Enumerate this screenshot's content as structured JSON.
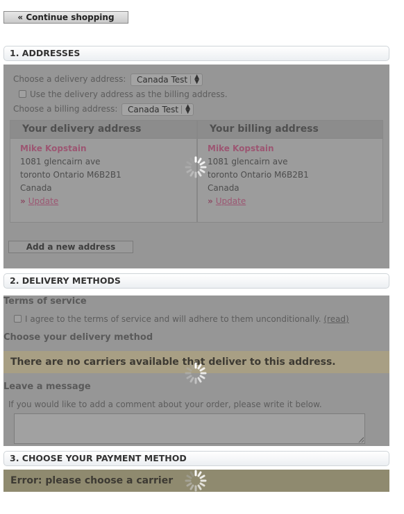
{
  "continue_shopping": {
    "label": "« Continue shopping"
  },
  "steps": {
    "addresses": {
      "title": "1. ADDRESSES",
      "delivery_label": "Choose a delivery address:",
      "delivery_selected": "Canada Test",
      "same_billing_label": "Use the delivery address as the billing address.",
      "billing_label": "Choose a billing address:",
      "billing_selected": "Canada Test",
      "delivery_box": {
        "title": "Your delivery address",
        "name": "Mike Kopstain",
        "line1": "1081 glencairn ave",
        "line2": "toronto Ontario M6B2B1",
        "country": "Canada",
        "update": "Update"
      },
      "billing_box": {
        "title": "Your billing address",
        "name": "Mike Kopstain",
        "line1": "1081 glencairn ave",
        "line2": "toronto Ontario M6B2B1",
        "country": "Canada",
        "update": "Update"
      },
      "add_new": "Add a new address"
    },
    "delivery": {
      "title": "2. DELIVERY METHODS",
      "terms_heading": "Terms of service",
      "terms_label": "I agree to the terms of service and will adhere to them unconditionally.",
      "terms_link": "(read)",
      "method_heading": "Choose your delivery method",
      "no_carriers": "There are no carriers available that deliver to this address.",
      "message_heading": "Leave a message",
      "message_hint": "If you would like to add a comment about your order, please write it below.",
      "message_value": ""
    },
    "payment": {
      "title": "3. CHOOSE YOUR PAYMENT METHOD",
      "error": "Error: please choose a carrier"
    }
  },
  "colors": {
    "overlay": "#969696",
    "warning_bg": "#a89f84",
    "error_bg": "#8f8a6f",
    "name_accent": "#9c5672"
  },
  "icons": {
    "loading": "spinner-icon",
    "select_arrows": "updown-arrows-icon",
    "link_chevron": "double-chevron-icon"
  }
}
